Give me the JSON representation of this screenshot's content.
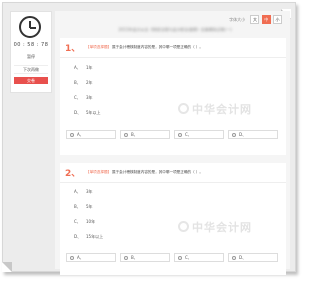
{
  "timer": "00 : 58 : 78",
  "side": {
    "pause_label": "暂停",
    "tip_label": "下次再做",
    "submit_label": "交卷"
  },
  "toolbar": {
    "font_label": "字体大小",
    "font_sizes": [
      "大",
      "中",
      "小"
    ],
    "active_size": "中"
  },
  "page_heading": "2015年会计从业《财经法规与会计职业道德》全真模拟试卷(一)",
  "watermark": "中华会计网",
  "questions": [
    {
      "number": "1、",
      "type": "【单项选择题】",
      "text": "属于会计稽核制度内容的是，其中哪一项是正确的（ ）。",
      "options": [
        {
          "letter": "A、",
          "text": "1年"
        },
        {
          "letter": "B、",
          "text": "2年"
        },
        {
          "letter": "C、",
          "text": "3年"
        },
        {
          "letter": "D、",
          "text": "5年以上"
        }
      ],
      "answers": [
        "A、",
        "B、",
        "C、",
        "D、"
      ]
    },
    {
      "number": "2、",
      "type": "【单项选择题】",
      "text": "属于会计稽核制度内容的是，其中哪一项是正确的（ ）。",
      "options": [
        {
          "letter": "A、",
          "text": "3年"
        },
        {
          "letter": "B、",
          "text": "5年"
        },
        {
          "letter": "C、",
          "text": "10年"
        },
        {
          "letter": "D、",
          "text": "15年以上"
        }
      ],
      "answers": [
        "A、",
        "B、",
        "C、",
        "D、"
      ]
    }
  ],
  "colors": {
    "accent": "#f06d52",
    "submit": "#e8504d",
    "background": "#ececec"
  }
}
